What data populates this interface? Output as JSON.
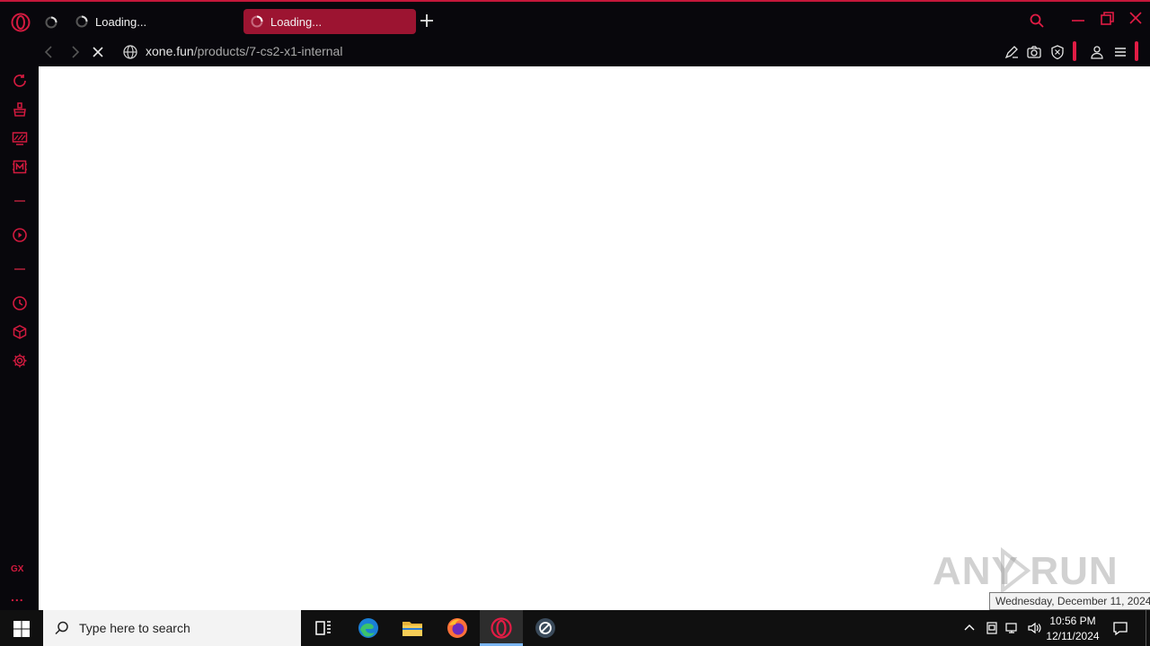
{
  "browser": {
    "tabs": [
      {
        "title": "Loading...",
        "active": false
      },
      {
        "title": "Loading...",
        "active": true
      }
    ],
    "address": {
      "domain": "xone.fun",
      "path": "/products/7-cs2-x1-internal"
    },
    "accent_color": "#e21c45"
  },
  "sidebar": {
    "items": [
      "refresh-icon",
      "cleaner-icon",
      "gaming-icon",
      "music-icon",
      "player-icon",
      "history-icon",
      "extensions-icon",
      "settings-icon"
    ],
    "gx_label": "GX",
    "more_label": "..."
  },
  "watermark": {
    "text": "ANY RUN"
  },
  "tooltip": {
    "text": "Wednesday, December 11, 2024"
  },
  "taskbar": {
    "search_placeholder": "Type here to search",
    "time": "10:56 PM",
    "date": "12/11/2024"
  }
}
